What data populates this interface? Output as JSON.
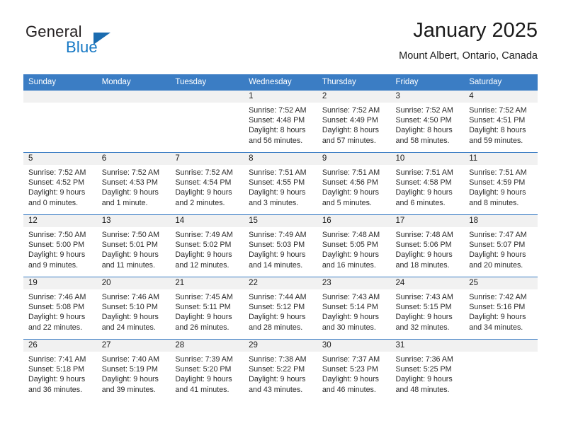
{
  "brand": {
    "name_part1": "General",
    "name_part2": "Blue",
    "accent_color": "#1477c4",
    "triangle_color": "#1b6cb0"
  },
  "header": {
    "month_title": "January 2025",
    "location": "Mount Albert, Ontario, Canada"
  },
  "theme": {
    "header_row_color": "#3b7dc4",
    "daynum_band_color": "#f1f1f1",
    "grid_line_color": "#3b7dc4"
  },
  "weekday_headers": [
    "Sunday",
    "Monday",
    "Tuesday",
    "Wednesday",
    "Thursday",
    "Friday",
    "Saturday"
  ],
  "weeks": [
    [
      {
        "day": "",
        "lines": []
      },
      {
        "day": "",
        "lines": []
      },
      {
        "day": "",
        "lines": []
      },
      {
        "day": "1",
        "lines": [
          "Sunrise: 7:52 AM",
          "Sunset: 4:48 PM",
          "Daylight: 8 hours",
          "and 56 minutes."
        ]
      },
      {
        "day": "2",
        "lines": [
          "Sunrise: 7:52 AM",
          "Sunset: 4:49 PM",
          "Daylight: 8 hours",
          "and 57 minutes."
        ]
      },
      {
        "day": "3",
        "lines": [
          "Sunrise: 7:52 AM",
          "Sunset: 4:50 PM",
          "Daylight: 8 hours",
          "and 58 minutes."
        ]
      },
      {
        "day": "4",
        "lines": [
          "Sunrise: 7:52 AM",
          "Sunset: 4:51 PM",
          "Daylight: 8 hours",
          "and 59 minutes."
        ]
      }
    ],
    [
      {
        "day": "5",
        "lines": [
          "Sunrise: 7:52 AM",
          "Sunset: 4:52 PM",
          "Daylight: 9 hours",
          "and 0 minutes."
        ]
      },
      {
        "day": "6",
        "lines": [
          "Sunrise: 7:52 AM",
          "Sunset: 4:53 PM",
          "Daylight: 9 hours",
          "and 1 minute."
        ]
      },
      {
        "day": "7",
        "lines": [
          "Sunrise: 7:52 AM",
          "Sunset: 4:54 PM",
          "Daylight: 9 hours",
          "and 2 minutes."
        ]
      },
      {
        "day": "8",
        "lines": [
          "Sunrise: 7:51 AM",
          "Sunset: 4:55 PM",
          "Daylight: 9 hours",
          "and 3 minutes."
        ]
      },
      {
        "day": "9",
        "lines": [
          "Sunrise: 7:51 AM",
          "Sunset: 4:56 PM",
          "Daylight: 9 hours",
          "and 5 minutes."
        ]
      },
      {
        "day": "10",
        "lines": [
          "Sunrise: 7:51 AM",
          "Sunset: 4:58 PM",
          "Daylight: 9 hours",
          "and 6 minutes."
        ]
      },
      {
        "day": "11",
        "lines": [
          "Sunrise: 7:51 AM",
          "Sunset: 4:59 PM",
          "Daylight: 9 hours",
          "and 8 minutes."
        ]
      }
    ],
    [
      {
        "day": "12",
        "lines": [
          "Sunrise: 7:50 AM",
          "Sunset: 5:00 PM",
          "Daylight: 9 hours",
          "and 9 minutes."
        ]
      },
      {
        "day": "13",
        "lines": [
          "Sunrise: 7:50 AM",
          "Sunset: 5:01 PM",
          "Daylight: 9 hours",
          "and 11 minutes."
        ]
      },
      {
        "day": "14",
        "lines": [
          "Sunrise: 7:49 AM",
          "Sunset: 5:02 PM",
          "Daylight: 9 hours",
          "and 12 minutes."
        ]
      },
      {
        "day": "15",
        "lines": [
          "Sunrise: 7:49 AM",
          "Sunset: 5:03 PM",
          "Daylight: 9 hours",
          "and 14 minutes."
        ]
      },
      {
        "day": "16",
        "lines": [
          "Sunrise: 7:48 AM",
          "Sunset: 5:05 PM",
          "Daylight: 9 hours",
          "and 16 minutes."
        ]
      },
      {
        "day": "17",
        "lines": [
          "Sunrise: 7:48 AM",
          "Sunset: 5:06 PM",
          "Daylight: 9 hours",
          "and 18 minutes."
        ]
      },
      {
        "day": "18",
        "lines": [
          "Sunrise: 7:47 AM",
          "Sunset: 5:07 PM",
          "Daylight: 9 hours",
          "and 20 minutes."
        ]
      }
    ],
    [
      {
        "day": "19",
        "lines": [
          "Sunrise: 7:46 AM",
          "Sunset: 5:08 PM",
          "Daylight: 9 hours",
          "and 22 minutes."
        ]
      },
      {
        "day": "20",
        "lines": [
          "Sunrise: 7:46 AM",
          "Sunset: 5:10 PM",
          "Daylight: 9 hours",
          "and 24 minutes."
        ]
      },
      {
        "day": "21",
        "lines": [
          "Sunrise: 7:45 AM",
          "Sunset: 5:11 PM",
          "Daylight: 9 hours",
          "and 26 minutes."
        ]
      },
      {
        "day": "22",
        "lines": [
          "Sunrise: 7:44 AM",
          "Sunset: 5:12 PM",
          "Daylight: 9 hours",
          "and 28 minutes."
        ]
      },
      {
        "day": "23",
        "lines": [
          "Sunrise: 7:43 AM",
          "Sunset: 5:14 PM",
          "Daylight: 9 hours",
          "and 30 minutes."
        ]
      },
      {
        "day": "24",
        "lines": [
          "Sunrise: 7:43 AM",
          "Sunset: 5:15 PM",
          "Daylight: 9 hours",
          "and 32 minutes."
        ]
      },
      {
        "day": "25",
        "lines": [
          "Sunrise: 7:42 AM",
          "Sunset: 5:16 PM",
          "Daylight: 9 hours",
          "and 34 minutes."
        ]
      }
    ],
    [
      {
        "day": "26",
        "lines": [
          "Sunrise: 7:41 AM",
          "Sunset: 5:18 PM",
          "Daylight: 9 hours",
          "and 36 minutes."
        ]
      },
      {
        "day": "27",
        "lines": [
          "Sunrise: 7:40 AM",
          "Sunset: 5:19 PM",
          "Daylight: 9 hours",
          "and 39 minutes."
        ]
      },
      {
        "day": "28",
        "lines": [
          "Sunrise: 7:39 AM",
          "Sunset: 5:20 PM",
          "Daylight: 9 hours",
          "and 41 minutes."
        ]
      },
      {
        "day": "29",
        "lines": [
          "Sunrise: 7:38 AM",
          "Sunset: 5:22 PM",
          "Daylight: 9 hours",
          "and 43 minutes."
        ]
      },
      {
        "day": "30",
        "lines": [
          "Sunrise: 7:37 AM",
          "Sunset: 5:23 PM",
          "Daylight: 9 hours",
          "and 46 minutes."
        ]
      },
      {
        "day": "31",
        "lines": [
          "Sunrise: 7:36 AM",
          "Sunset: 5:25 PM",
          "Daylight: 9 hours",
          "and 48 minutes."
        ]
      },
      {
        "day": "",
        "lines": []
      }
    ]
  ]
}
